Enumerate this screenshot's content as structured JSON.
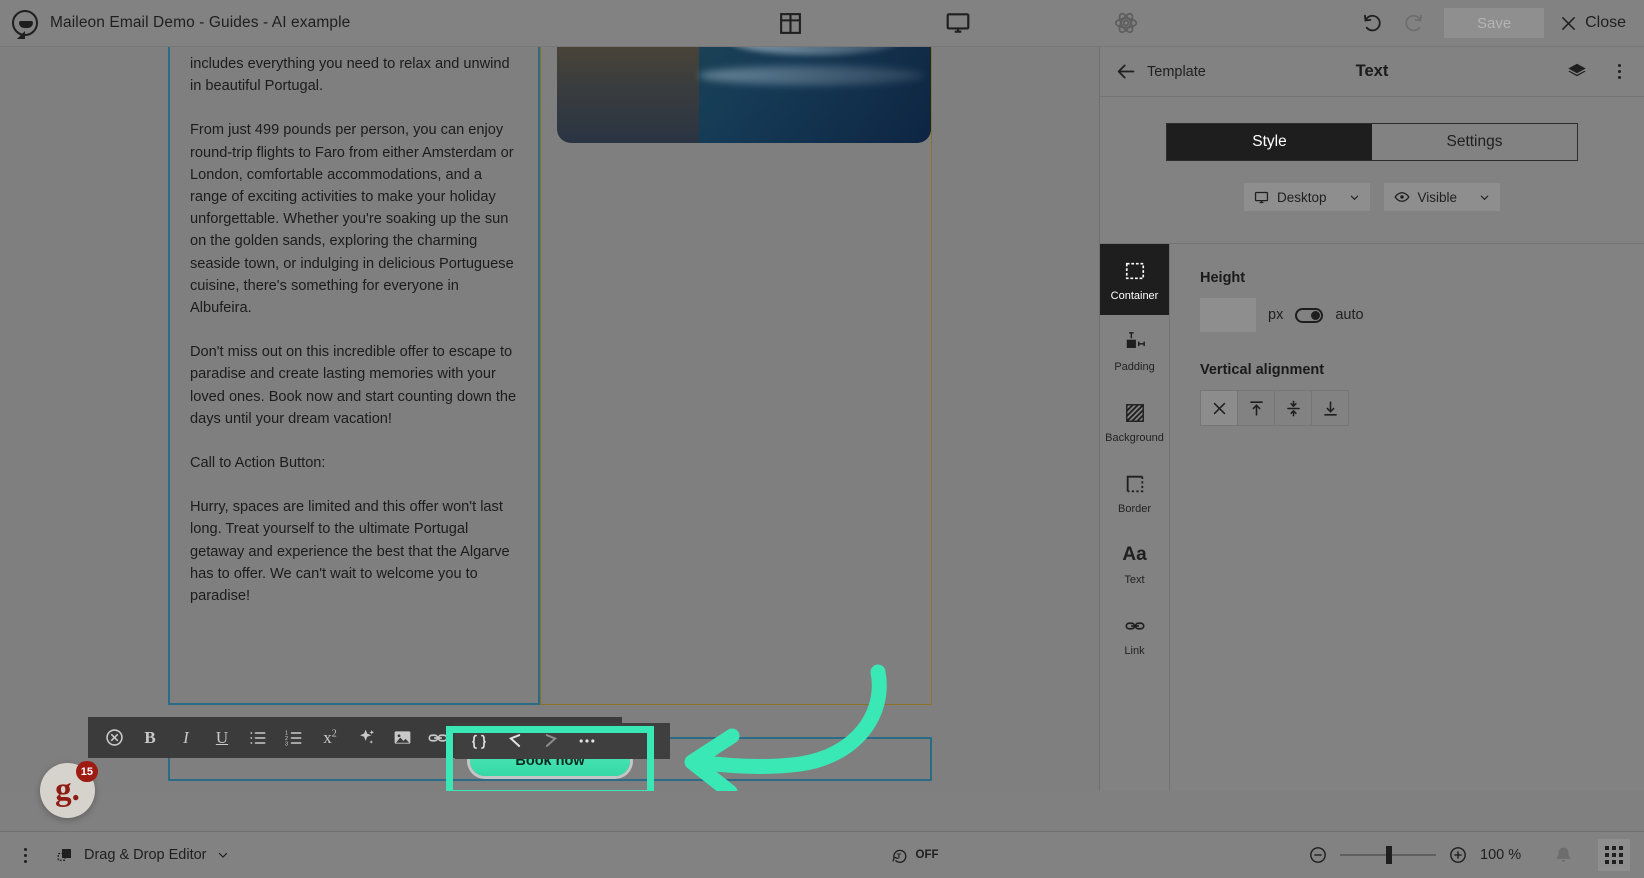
{
  "topbar": {
    "logo_icon": "maileon-chat-logo-icon",
    "document_title": "Maileon Email Demo - Guides - AI example",
    "center_icons": [
      {
        "name": "layout-blocks-icon",
        "label": "Blocks"
      },
      {
        "name": "desktop-preview-icon",
        "label": "Desktop preview"
      },
      {
        "name": "atom-settings-icon",
        "label": "Settings"
      }
    ],
    "undo_label": "Undo",
    "redo_label": "Redo",
    "save_label": "Save",
    "close_label": "Close"
  },
  "email": {
    "paragraphs": [
      "includes everything you need to relax and unwind in beautiful Portugal.",
      "From just 499 pounds per person, you can enjoy round-trip flights to Faro from either Amsterdam or London, comfortable accommodations, and a range of exciting activities to make your holiday unforgettable. Whether you're soaking up the sun on the golden sands, exploring the charming seaside town, or indulging in delicious Portuguese cuisine, there's something for everyone in Albufeira.",
      "Don't miss out on this incredible offer to escape to paradise and create lasting memories with your loved ones. Book now and start counting down the days until your dream vacation!",
      "Call to Action Button:",
      "Hurry, spaces are limited and this offer won't last long. Treat yourself to the ultimate Portugal getaway and experience the best that the Algarve has to offer. We can't wait to welcome you to paradise!"
    ],
    "hero_image_alt": "beach-photo",
    "cta_button_label": "Book now"
  },
  "rich_text_toolbar": {
    "buttons": [
      {
        "name": "clear-formatting-icon",
        "label": "Clear formatting"
      },
      {
        "name": "bold-icon",
        "label": "B"
      },
      {
        "name": "italic-icon",
        "label": "I"
      },
      {
        "name": "underline-icon",
        "label": "U"
      },
      {
        "name": "bullet-list-icon",
        "label": "Bulleted list"
      },
      {
        "name": "numbered-list-icon",
        "label": "Numbered list"
      },
      {
        "name": "superscript-icon",
        "label": "x2"
      },
      {
        "name": "ai-sparkle-icon",
        "label": "AI assist"
      },
      {
        "name": "insert-image-icon",
        "label": "Insert image"
      },
      {
        "name": "insert-link-icon",
        "label": "Insert link"
      }
    ],
    "overflow_buttons": [
      {
        "name": "source-code-icon",
        "label": "Source code"
      },
      {
        "name": "undo-edit-icon",
        "label": "Undo"
      },
      {
        "name": "redo-edit-icon",
        "label": "Redo"
      },
      {
        "name": "more-options-icon",
        "label": "More"
      }
    ]
  },
  "annotation": {
    "highlight_color": "#3ae8b5",
    "arrow_color": "#3ae8b5",
    "target": "Book now"
  },
  "panel": {
    "back_label": "Template",
    "title": "Text",
    "layers_icon": "layers-icon",
    "more_icon": "kebab-menu-icon",
    "tabs": [
      {
        "label": "Style",
        "active": true
      },
      {
        "label": "Settings",
        "active": false
      }
    ],
    "device_select": {
      "icon": "monitor-icon",
      "value": "Desktop"
    },
    "visibility_select": {
      "icon": "eye-icon",
      "value": "Visible"
    },
    "side_tabs": [
      {
        "label": "Container",
        "icon": "container-icon",
        "active": true
      },
      {
        "label": "Padding",
        "icon": "padding-icon",
        "active": false
      },
      {
        "label": "Background",
        "icon": "background-hatch-icon",
        "active": false
      },
      {
        "label": "Border",
        "icon": "border-icon",
        "active": false
      },
      {
        "label": "Text",
        "icon": "text-aa-icon",
        "active": false
      },
      {
        "label": "Link",
        "icon": "link-chain-icon",
        "active": false
      }
    ],
    "height": {
      "label": "Height",
      "value": "",
      "unit": "px",
      "auto_label": "auto",
      "auto_on": true
    },
    "vertical_alignment": {
      "label": "Vertical alignment",
      "options": [
        {
          "name": "valign-none",
          "active": true
        },
        {
          "name": "valign-top",
          "active": false
        },
        {
          "name": "valign-middle",
          "active": false
        },
        {
          "name": "valign-bottom",
          "active": false
        }
      ]
    }
  },
  "bottombar": {
    "kebab_icon": "kebab-menu-icon",
    "editor_icon": "drag-drop-icon",
    "editor_label": "Drag & Drop Editor",
    "preview_toggle": {
      "icon": "text-rotate-icon",
      "label": "OFF"
    },
    "zoom": {
      "minus": "-",
      "plus": "+",
      "value": "100 %"
    },
    "bell_icon": "notification-bell-icon",
    "grid_icon": "apps-grid-icon"
  },
  "floating_badge": {
    "logo_text": "g.",
    "count": "15"
  }
}
